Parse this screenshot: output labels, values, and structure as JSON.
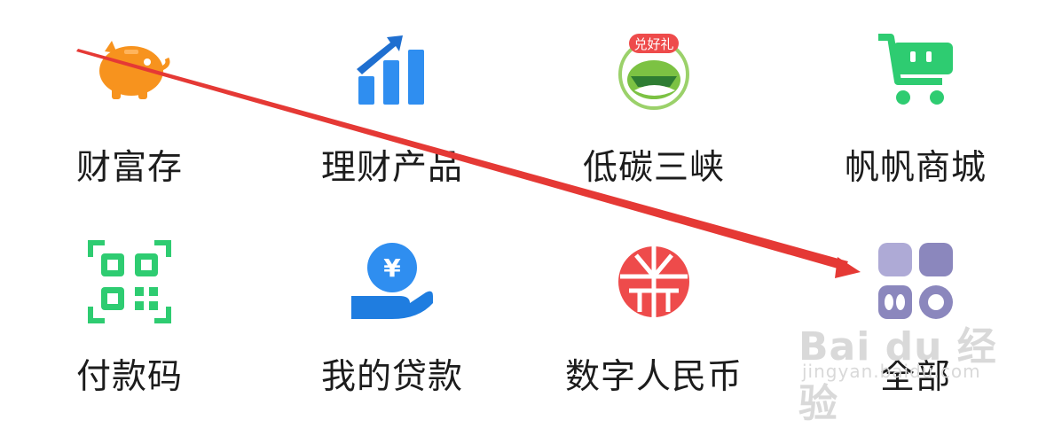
{
  "menu": {
    "items": [
      {
        "label": "财富存",
        "icon": "piggy-bank-icon",
        "color": "#f7931e"
      },
      {
        "label": "理财产品",
        "icon": "rising-chart-icon",
        "color": "#2f8ef0"
      },
      {
        "label": "低碳三峡",
        "icon": "gift-badge-icon",
        "badge": "兑好礼",
        "color": "#7cc243"
      },
      {
        "label": "帆帆商城",
        "icon": "shopping-cart-icon",
        "color": "#2ecc71"
      },
      {
        "label": "付款码",
        "icon": "qr-code-icon",
        "color": "#2ecc71"
      },
      {
        "label": "我的贷款",
        "icon": "yuan-hand-icon",
        "color": "#2f8ef0"
      },
      {
        "label": "数字人民币",
        "icon": "digital-yuan-icon",
        "color": "#ee4b4b"
      },
      {
        "label": "全部",
        "icon": "all-apps-icon",
        "color": "#8b87bd"
      }
    ]
  },
  "annotation": {
    "arrow_color": "#e53935"
  },
  "watermark": {
    "main": "Bai du 经验",
    "sub": "jingyan.baidu.com"
  }
}
